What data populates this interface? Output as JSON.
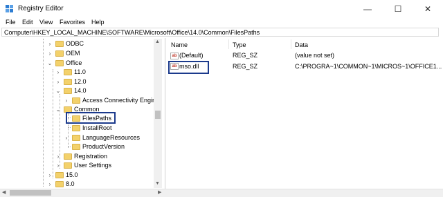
{
  "window": {
    "title": "Registry Editor",
    "minimize": "—",
    "maximize": "☐",
    "close": "✕"
  },
  "menu": [
    "File",
    "Edit",
    "View",
    "Favorites",
    "Help"
  ],
  "address": "Computer\\HKEY_LOCAL_MACHINE\\SOFTWARE\\Microsoft\\Office\\14.0\\Common\\FilesPaths",
  "tree": {
    "odbc": "ODBC",
    "oem": "OEM",
    "office": "Office",
    "v11": "11.0",
    "v12": "12.0",
    "v14": "14.0",
    "access": "Access Connectivity Engine",
    "common": "Common",
    "filespaths": "FilesPaths",
    "installroot": "InstallRoot",
    "langres": "LanguageResources",
    "productversion": "ProductVersion",
    "registration": "Registration",
    "usersettings": "User Settings",
    "v15": "15.0",
    "v8": "8.0"
  },
  "list": {
    "headers": {
      "name": "Name",
      "type": "Type",
      "data": "Data"
    },
    "rows": [
      {
        "icon": "ab",
        "name": "(Default)",
        "type": "REG_SZ",
        "data": "(value not set)"
      },
      {
        "icon": "ab",
        "name": "mso.dll",
        "type": "REG_SZ",
        "data": "C:\\PROGRA~1\\COMMON~1\\MICROS~1\\OFFICE1..."
      }
    ]
  },
  "icons": {
    "app": "registry-editor-icon",
    "folder": "folder-icon",
    "string-value": "string-value-icon"
  },
  "colors": {
    "folder": "#f3d16b",
    "highlight": "#1b3a8c"
  }
}
